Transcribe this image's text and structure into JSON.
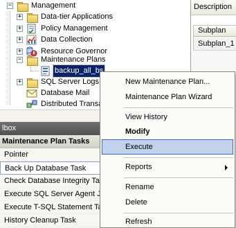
{
  "tree": {
    "items": [
      {
        "label": "Management",
        "expander": "−",
        "icon": "folder-icon"
      },
      {
        "label": "Data-tier Applications",
        "expander": "+",
        "icon": "folder-icon"
      },
      {
        "label": "Policy Management",
        "expander": "+",
        "icon": "policy-icon"
      },
      {
        "label": "Data Collection",
        "expander": "+",
        "icon": "data-collection-icon"
      },
      {
        "label": "Resource Governor",
        "expander": "+",
        "icon": "resource-governor-icon"
      },
      {
        "label": "Maintenance Plans",
        "expander": "−",
        "icon": "folder-icon"
      },
      {
        "label": "backup_all_bs",
        "expander": "",
        "icon": "maintenance-plan-icon"
      },
      {
        "label": "SQL Server Logs",
        "expander": "+",
        "icon": "folder-icon"
      },
      {
        "label": "Database Mail",
        "expander": "",
        "icon": "database-mail-icon"
      },
      {
        "label": "Distributed Transa",
        "expander": "",
        "icon": "distributed-transaction-icon"
      }
    ]
  },
  "right_pane": {
    "description_header": "Description",
    "grid_header": "Subplan",
    "grid_cell": "Subplan_1"
  },
  "toolbox": {
    "title": "lbox",
    "group": "Maintenance Plan Tasks",
    "items": [
      {
        "label": "Pointer"
      },
      {
        "label": "Back Up Database Task"
      },
      {
        "label": "Check Database Integrity Ta"
      },
      {
        "label": "Execute SQL Server Agent Jo"
      },
      {
        "label": "Execute T-SQL Statement Ta"
      },
      {
        "label": "History Cleanup Task"
      }
    ]
  },
  "context_menu": {
    "items": [
      {
        "label": "New Maintenance Plan..."
      },
      {
        "label": "Maintenance Plan Wizard"
      },
      {
        "label": "View History"
      },
      {
        "label": "Modify"
      },
      {
        "label": "Execute"
      },
      {
        "label": "Reports"
      },
      {
        "label": "Rename"
      },
      {
        "label": "Delete"
      },
      {
        "label": "Refresh"
      }
    ]
  },
  "colors": {
    "selection": "#0a246a",
    "menu_highlight": "#c1d2ee",
    "menu_highlight_border": "#316ac5"
  }
}
